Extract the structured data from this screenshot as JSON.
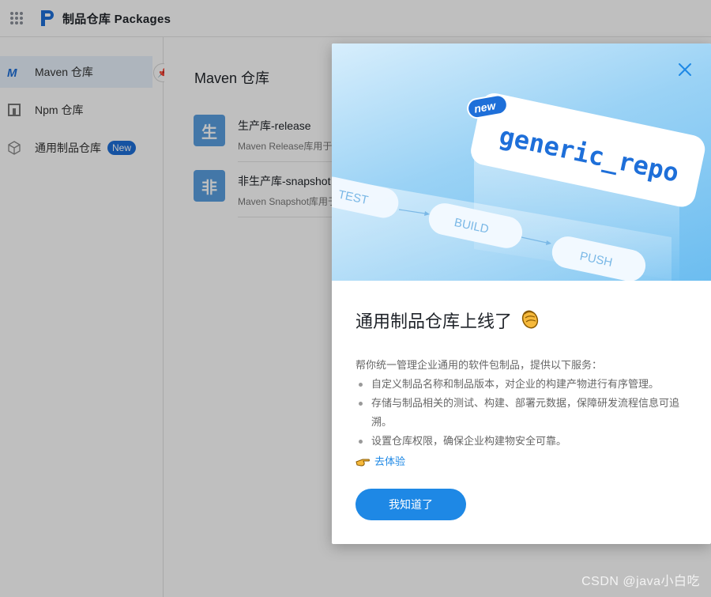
{
  "header": {
    "app_title": "制品仓库 Packages"
  },
  "sidebar": {
    "items": [
      {
        "label": "Maven 仓库",
        "icon": "maven-icon",
        "active": true
      },
      {
        "label": "Npm 仓库",
        "icon": "npm-icon",
        "active": false
      },
      {
        "label": "通用制品仓库",
        "icon": "cube-icon",
        "active": false,
        "badge": "New"
      }
    ]
  },
  "main": {
    "title": "Maven 仓库",
    "repos": [
      {
        "avatar": "生",
        "name": "生产库-release",
        "desc": "Maven Release库用于存"
      },
      {
        "avatar": "非",
        "name": "非生产库-snapshot",
        "desc": "Maven Snapshot库用于"
      }
    ]
  },
  "modal": {
    "banner": {
      "badge": "new",
      "card_text": "generic_repo",
      "stages": [
        "TEST",
        "BUILD",
        "PUSH"
      ]
    },
    "title": "通用制品仓库上线了",
    "intro": "帮你统一管理企业通用的软件包制品，提供以下服务：",
    "bullets": [
      "自定义制品名称和制品版本，对企业的构建产物进行有序管理。",
      "存储与制品相关的测试、构建、部署元数据，保障研发流程信息可追溯。",
      "设置仓库权限，确保企业构建物安全可靠。"
    ],
    "try_label": "去体验",
    "confirm_label": "我知道了"
  },
  "watermark": "CSDN @java小白吃",
  "colors": {
    "accent": "#1e88e5",
    "badge": "#1e6fd9",
    "overlay": "rgba(0,0,0,0.25)"
  }
}
